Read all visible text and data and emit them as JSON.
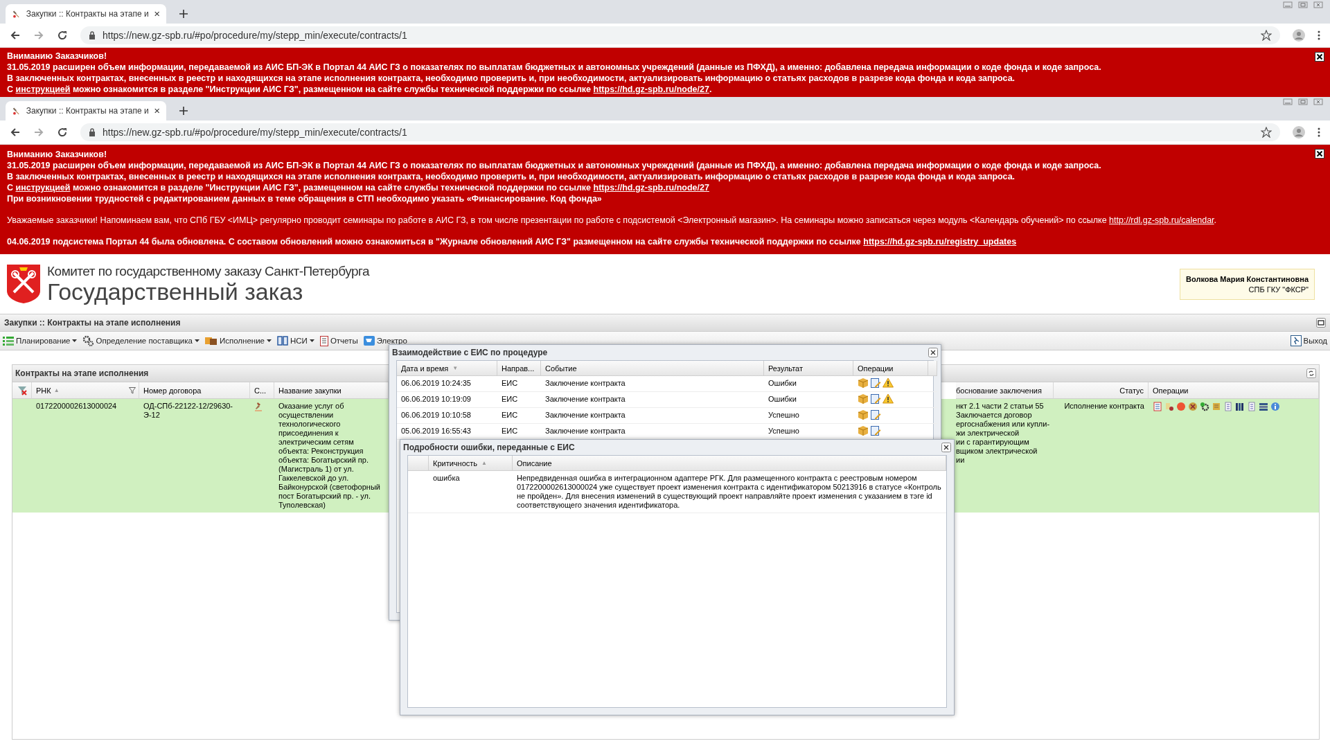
{
  "browser_frames": [
    {
      "tab_title": "Закупки :: Контракты на этапе и",
      "url": "https://new.gz-spb.ru/#po/procedure/my/stepp_min/execute/contracts/1",
      "banner": {
        "paragraphs": [
          {
            "bold": true,
            "lines": [
              [
                {
                  "text": "Вниманию Заказчиков!",
                  "link": false
                }
              ],
              [
                {
                  "text": "31.05.2019 расширен объем информации, передаваемой из АИС БП-ЭК в Портал 44 АИС ГЗ о показателях по выплатам бюджетных и автономных учреждений (данные из ПФХД), а именно: добавлена передача информации о коде фонда и коде запроса.",
                  "link": false
                }
              ],
              [
                {
                  "text": "В заключенных контрактах, внесенных в реестр и находящихся на этапе исполнения контракта, необходимо проверить и, при необходимости, актуализировать информацию о статьях расходов в разрезе кода фонда и кода запроса.",
                  "link": false
                }
              ],
              [
                {
                  "text": "С ",
                  "link": false
                },
                {
                  "text": "инструкцией",
                  "link": true
                },
                {
                  "text": " можно ознакомится в разделе \"Инструкции АИС ГЗ\", размещенном на сайте службы технической поддержки по ссылке ",
                  "link": false
                },
                {
                  "text": "https://hd.gz-spb.ru/node/27",
                  "link": true
                },
                {
                  "text": ".",
                  "link": false
                }
              ]
            ]
          }
        ]
      }
    },
    {
      "tab_title": "Закупки :: Контракты на этапе и",
      "url": "https://new.gz-spb.ru/#po/procedure/my/stepp_min/execute/contracts/1",
      "banner": {
        "paragraphs": [
          {
            "bold": true,
            "lines": [
              [
                {
                  "text": "Вниманию Заказчиков!",
                  "link": false
                }
              ],
              [
                {
                  "text": "31.05.2019 расширен объем информации, передаваемой из АИС БП-ЭК в Портал 44 АИС ГЗ о показателях по выплатам бюджетных и автономных учреждений (данные из ПФХД), а именно: добавлена передача информации о коде фонда и коде запроса.",
                  "link": false
                }
              ],
              [
                {
                  "text": "В заключенных контрактах, внесенных в реестр и находящихся на этапе исполнения контракта, необходимо проверить и, при необходимости, актуализировать информацию о статьях расходов в разрезе кода фонда и кода запроса.",
                  "link": false
                }
              ],
              [
                {
                  "text": "С ",
                  "link": false
                },
                {
                  "text": "инструкцией",
                  "link": true
                },
                {
                  "text": " можно ознакомится в разделе \"Инструкции АИС ГЗ\", размещенном на сайте службы технической поддержки по ссылке ",
                  "link": false
                },
                {
                  "text": "https://hd.gz-spb.ru/node/27",
                  "link": true
                }
              ],
              [
                {
                  "text": "При возникновении трудностей с редактированием данных в теме обращения в СТП необходимо указать «Финансирование. Код фонда»",
                  "link": false
                }
              ]
            ]
          },
          {
            "bold": false,
            "lines": [
              [
                {
                  "text": "Уважаемые заказчики! Напоминаем вам, что СПб ГБУ <ИМЦ> регулярно проводит семинары по работе в АИС ГЗ, в том числе презентации по работе с подсистемой <Электронный магазин>. На семинары можно записаться через модуль <Календарь обучений> по ссылке ",
                  "link": false
                },
                {
                  "text": "http://rdl.gz-spb.ru/calendar",
                  "link": true
                },
                {
                  "text": ".",
                  "link": false
                }
              ]
            ]
          },
          {
            "bold": true,
            "lines": [
              [
                {
                  "text": "04.06.2019 подсистема Портал 44 была обновлена. С составом обновлений можно ознакомиться в \"Журнале обновлений АИС ГЗ\" размещенном на сайте службы технической поддержки по ссылке ",
                  "link": false
                },
                {
                  "text": "https://hd.gz-spb.ru/registry_updates",
                  "link": true
                }
              ]
            ]
          }
        ]
      }
    }
  ],
  "header": {
    "org": "Комитет по государственному заказу Санкт-Петербурга",
    "title": "Государственный заказ",
    "user": {
      "name": "Волкова Мария Константиновна",
      "org": "СПБ ГКУ \"ФКСР\""
    }
  },
  "app": {
    "title": "Закупки :: Контракты на этапе исполнения",
    "toolbar": [
      {
        "label": "Планирование",
        "dropdown": true
      },
      {
        "label": "Определение поставщика",
        "dropdown": true
      },
      {
        "label": "Исполнение",
        "dropdown": true
      },
      {
        "label": "НСИ",
        "dropdown": true
      },
      {
        "label": "Отчеты",
        "dropdown": false
      },
      {
        "label": "Электро",
        "dropdown": false
      }
    ],
    "exit": "Выход",
    "grid": {
      "title": "Контракты на этапе исполнения",
      "columns": [
        {
          "label": "РНК",
          "sort_mark": "▲",
          "filter": true
        },
        {
          "label": "Номер договора",
          "filter": false
        },
        {
          "label": "С...",
          "filter": false
        },
        {
          "label": "Название закупки",
          "filter": false
        },
        {
          "label": "боснование заключения",
          "filter": false
        },
        {
          "label": "Статус",
          "filter": false
        },
        {
          "label": "Операции",
          "filter": false
        }
      ],
      "rows": [
        {
          "rnk": "0172200002613000024",
          "number": "ОД-СПб-22122-12/29630-Э-12",
          "name": "Оказание услуг об осуществлении технологического присоединения к электрическим сетям объекта: Реконструкция объекта: Богатырский пр. (Магистраль 1) от ул. Гаккелевской до ул. Байконурской (светофорный пост Богатырский пр. - ул. Туполевская)",
          "basis": [
            "нкт 2.1 части 2 статьи 55",
            "Заключается договор",
            "ергоснабжения или купли-",
            "жи электрической",
            "ии с гарантирующим",
            "вщиком электрической",
            "ии"
          ],
          "status": "Исполнение контракта",
          "selected": true
        }
      ]
    }
  },
  "dialogs": [
    {
      "title": "Взаимодействие с ЕИС по процедуре",
      "columns": [
        {
          "label": "Дата и время",
          "sort_mark": "▼"
        },
        {
          "label": "Направ..."
        },
        {
          "label": "Событие"
        },
        {
          "label": "Результат"
        },
        {
          "label": "Операции"
        }
      ],
      "rows": [
        {
          "cells": [
            "06.06.2019 10:24:35",
            "ЕИС",
            "Заключение контракта",
            "Ошибки"
          ],
          "warning": true
        },
        {
          "cells": [
            "06.06.2019 10:19:09",
            "ЕИС",
            "Заключение контракта",
            "Ошибки"
          ],
          "warning": true
        },
        {
          "cells": [
            "06.06.2019 10:10:58",
            "ЕИС",
            "Заключение контракта",
            "Успешно"
          ],
          "warning": false
        },
        {
          "cells": [
            "05.06.2019 16:55:43",
            "ЕИС",
            "Заключение контракта",
            "Успешно"
          ],
          "warning": false
        }
      ]
    },
    {
      "title": "Подробности ошибки, переданные с ЕИС",
      "columns": [
        {
          "label": "Критичность",
          "sort_mark": "▲"
        },
        {
          "label": "Описание"
        }
      ],
      "rows": [
        {
          "cells": [
            "ошибка",
            "Непредвиденная ошибка в интеграционном адаптере РГК. Для размещенного контракта с реестровым номером 0172200002613000024 уже существует проект изменения контракта с идентификатором 50213916 в статусе «Контроль не пройден». Для внесения изменений в существующий проект направляйте проект изменения с указанием в тэге id соответствующего значения идентификатора."
          ]
        }
      ]
    }
  ]
}
